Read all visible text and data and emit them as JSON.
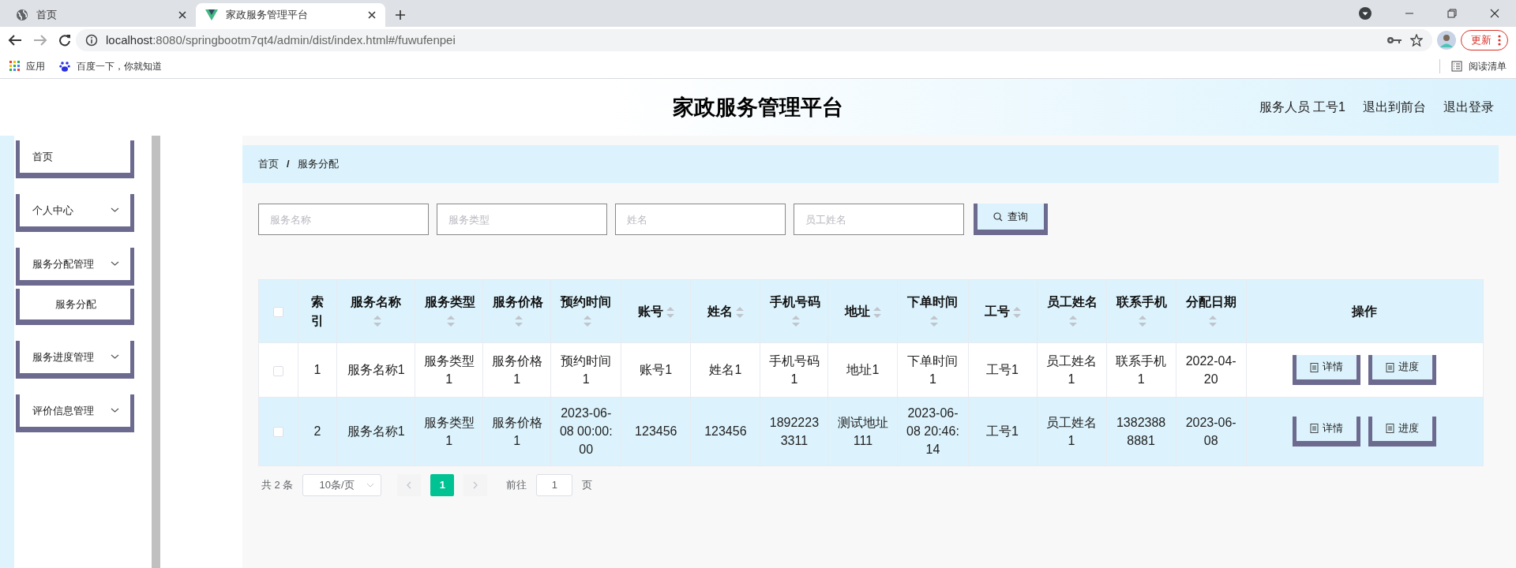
{
  "browser": {
    "tabs": [
      {
        "title": "首页",
        "selected": false
      },
      {
        "title": "家政服务管理平台",
        "selected": true
      }
    ],
    "url_host": "localhost",
    "url_rest": ":8080/springbootm7qt4/admin/dist/index.html#/fuwufenpei",
    "update_button": "更新",
    "bookmarks": [
      {
        "label": "应用"
      },
      {
        "label": "百度一下，你就知道"
      }
    ],
    "reading_list": "阅读清单"
  },
  "header": {
    "title": "家政服务管理平台",
    "user": "服务人员 工号1",
    "links": [
      "退出到前台",
      "退出登录"
    ]
  },
  "sidebar": {
    "items": [
      {
        "label": "首页",
        "kind": "link"
      },
      {
        "label": "个人中心",
        "kind": "submenu"
      },
      {
        "label": "服务分配管理",
        "kind": "submenu",
        "children": [
          {
            "label": "服务分配"
          }
        ]
      },
      {
        "label": "服务进度管理",
        "kind": "submenu"
      },
      {
        "label": "评价信息管理",
        "kind": "submenu"
      }
    ]
  },
  "breadcrumb": {
    "items": [
      "首页",
      "服务分配"
    ],
    "separator": "/"
  },
  "search": {
    "fields": [
      {
        "placeholder": "服务名称"
      },
      {
        "placeholder": "服务类型"
      },
      {
        "placeholder": "姓名"
      },
      {
        "placeholder": "员工姓名"
      }
    ],
    "button": "查询"
  },
  "table": {
    "select_all": {
      "checked": false
    },
    "columns": [
      {
        "label": "索引",
        "sortable": false
      },
      {
        "label": "服务名称",
        "sortable": true
      },
      {
        "label": "服务类型",
        "sortable": true
      },
      {
        "label": "服务价格",
        "sortable": true
      },
      {
        "label": "预约时间",
        "sortable": true
      },
      {
        "label": "账号",
        "sortable": true
      },
      {
        "label": "姓名",
        "sortable": true
      },
      {
        "label": "手机号码",
        "sortable": true
      },
      {
        "label": "地址",
        "sortable": true
      },
      {
        "label": "下单时间",
        "sortable": true
      },
      {
        "label": "工号",
        "sortable": true
      },
      {
        "label": "员工姓名",
        "sortable": true
      },
      {
        "label": "联系手机",
        "sortable": true
      },
      {
        "label": "分配日期",
        "sortable": true
      },
      {
        "label": "操作",
        "sortable": false
      }
    ],
    "rows": [
      {
        "checked": false,
        "cells": [
          "1",
          "服务名称1",
          "服务类型1",
          "服务价格1",
          "预约时间1",
          "账号1",
          "姓名1",
          "手机号码1",
          "地址1",
          "下单时间1",
          "工号1",
          "员工姓名1",
          "联系手机1",
          "2022-04-20"
        ],
        "actions": [
          "详情",
          "进度"
        ]
      },
      {
        "checked": false,
        "cells": [
          "2",
          "服务名称1",
          "服务类型1",
          "服务价格1",
          "2023-06-08 00:00:00",
          "123456",
          "123456",
          "18922233311",
          "测试地址111",
          "2023-06-08 20:46:14",
          "工号1",
          "员工姓名1",
          "13823888881",
          "2023-06-08"
        ],
        "actions": [
          "详情",
          "进度"
        ]
      }
    ]
  },
  "pagination": {
    "total": "共 2 条",
    "page_size": "10条/页",
    "pages": [
      {
        "label": "1",
        "selected": true
      }
    ],
    "goto_label": "前往",
    "goto_value": "1",
    "goto_suffix": "页"
  }
}
